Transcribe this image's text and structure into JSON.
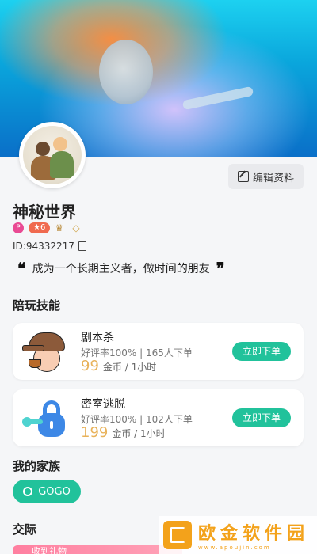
{
  "profile": {
    "nickname": "神秘世界",
    "level": "6",
    "id_text": "ID:94332217",
    "signature": "成为一个长期主义者，做时间的朋友",
    "quote_open": "❝",
    "quote_close": "❞",
    "badge_p": "P"
  },
  "header": {
    "edit_button": "编辑资料"
  },
  "sections": {
    "skills_title": "陪玩技能",
    "family_title": "我的家族",
    "social_title": "交际"
  },
  "skills": [
    {
      "name": "剧本杀",
      "stats": "好评率100% | 165人下单",
      "price": "99",
      "unit": "金币 / 1小时",
      "order": "立即下单",
      "icon": "detective-icon"
    },
    {
      "name": "密室逃脱",
      "stats": "好评率100% | 102人下单",
      "price": "199",
      "unit": "金币 / 1小时",
      "order": "立即下单",
      "icon": "lock-key-icon"
    }
  ],
  "family": {
    "name": "GOGO"
  },
  "social": {
    "gift_label": "收到礼物"
  },
  "watermark": {
    "title": "欧金软件园",
    "subtitle": "www.apoujin.com"
  },
  "colors": {
    "accent": "#21c29b",
    "price": "#e8b25a"
  }
}
